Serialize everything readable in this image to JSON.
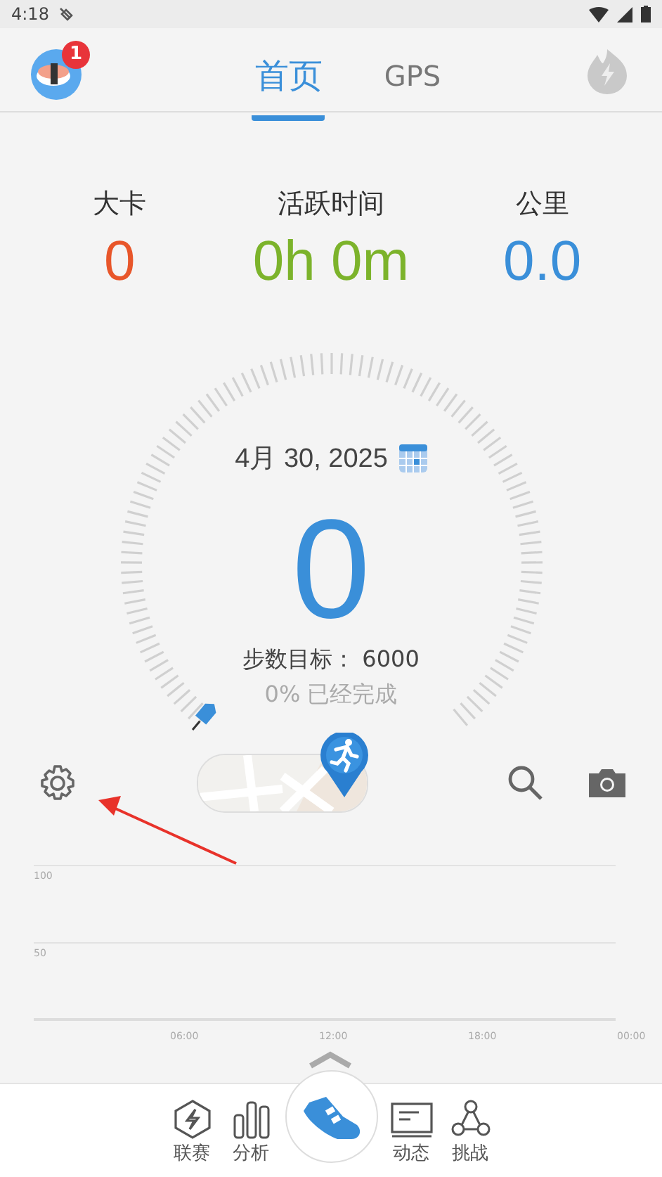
{
  "status_bar": {
    "time": "4:18"
  },
  "header": {
    "badge": "1",
    "tabs": [
      {
        "label": "首页",
        "selected": true
      },
      {
        "label": "GPS",
        "selected": false
      }
    ]
  },
  "stats": [
    {
      "label": "大卡",
      "value": "0",
      "color": "#e8562a"
    },
    {
      "label": "活跃时间",
      "value": "0h 0m",
      "color": "#7cb32b"
    },
    {
      "label": "公里",
      "value": "0.0",
      "color": "#3a8fd9"
    }
  ],
  "dial": {
    "date": "4月 30, 2025",
    "steps": "0",
    "goal": "步数目标： 6000",
    "completed": "0% 已经完成"
  },
  "chart": {
    "y_labels": [
      "100",
      "50"
    ],
    "x_labels": [
      "06:00",
      "12:00",
      "18:00",
      "00:00"
    ]
  },
  "nav": [
    {
      "label": "联赛",
      "selected": false
    },
    {
      "label": "分析",
      "selected": false
    },
    {
      "label": "动态",
      "selected": false
    },
    {
      "label": "挑战",
      "selected": false
    }
  ]
}
